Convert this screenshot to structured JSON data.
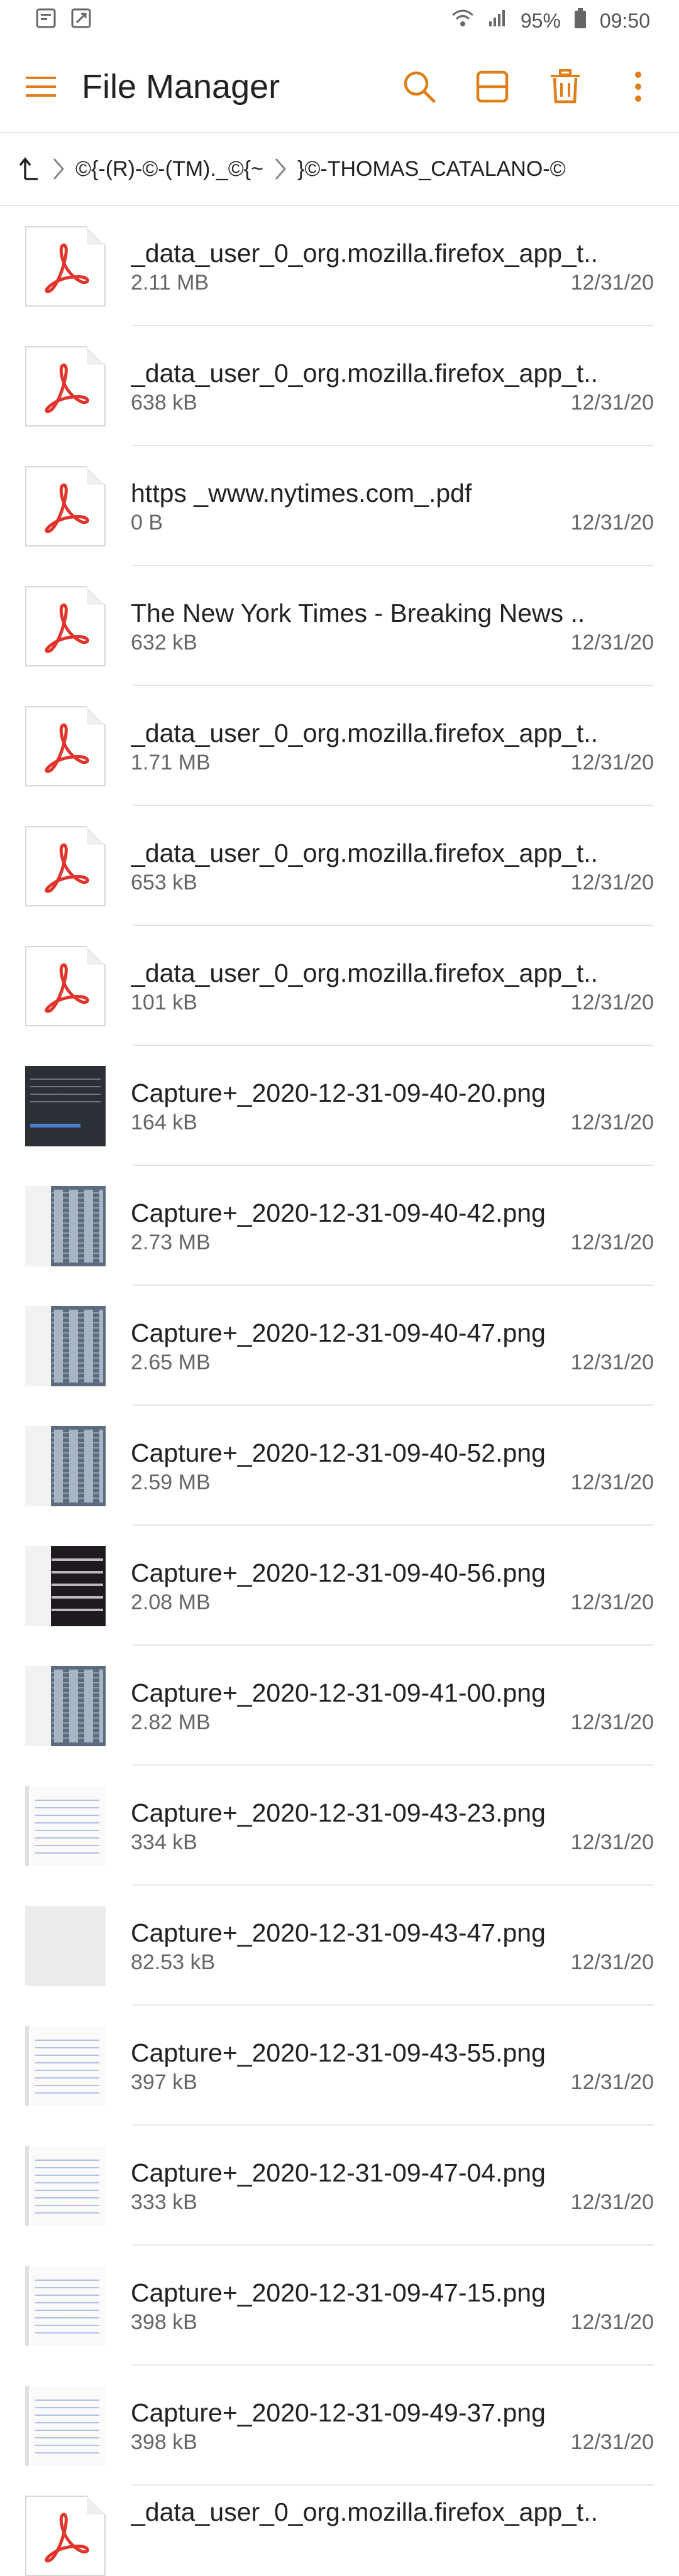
{
  "status": {
    "battery": "95%",
    "time": "09:50"
  },
  "appbar": {
    "title": "File Manager"
  },
  "breadcrumb": {
    "items": [
      "©{-(R)-©-(TM)._©{~",
      "}©-THOMAS_CATALANO-©"
    ]
  },
  "colors": {
    "accent": "#e07e1a",
    "pdf_red": "#e2342a"
  },
  "icons": [
    "menu-icon",
    "search-icon",
    "split-view-icon",
    "delete-icon",
    "more-icon",
    "up-arrow-icon",
    "chevron-right-icon",
    "pdf-icon"
  ],
  "files": [
    {
      "name": "_data_user_0_org.mozilla.firefox_app_t..",
      "size": "2.11 MB",
      "date": "12/31/20",
      "thumb": "pdf"
    },
    {
      "name": "_data_user_0_org.mozilla.firefox_app_t..",
      "size": "638 kB",
      "date": "12/31/20",
      "thumb": "pdf"
    },
    {
      "name": "https _www.nytimes.com_.pdf",
      "size": "0 B",
      "date": "12/31/20",
      "thumb": "pdf"
    },
    {
      "name": "The New York Times - Breaking News  ..",
      "size": "632 kB",
      "date": "12/31/20",
      "thumb": "pdf"
    },
    {
      "name": "_data_user_0_org.mozilla.firefox_app_t..",
      "size": "1.71 MB",
      "date": "12/31/20",
      "thumb": "pdf"
    },
    {
      "name": "_data_user_0_org.mozilla.firefox_app_t..",
      "size": "653 kB",
      "date": "12/31/20",
      "thumb": "pdf"
    },
    {
      "name": "_data_user_0_org.mozilla.firefox_app_t..",
      "size": "101 kB",
      "date": "12/31/20",
      "thumb": "pdf"
    },
    {
      "name": "Capture+_2020-12-31-09-40-20.png",
      "size": "164 kB",
      "date": "12/31/20",
      "thumb": "dark"
    },
    {
      "name": "Capture+_2020-12-31-09-40-42.png",
      "size": "2.73 MB",
      "date": "12/31/20",
      "thumb": "blue"
    },
    {
      "name": "Capture+_2020-12-31-09-40-47.png",
      "size": "2.65 MB",
      "date": "12/31/20",
      "thumb": "blue"
    },
    {
      "name": "Capture+_2020-12-31-09-40-52.png",
      "size": "2.59 MB",
      "date": "12/31/20",
      "thumb": "blue"
    },
    {
      "name": "Capture+_2020-12-31-09-40-56.png",
      "size": "2.08 MB",
      "date": "12/31/20",
      "thumb": "night"
    },
    {
      "name": "Capture+_2020-12-31-09-41-00.png",
      "size": "2.82 MB",
      "date": "12/31/20",
      "thumb": "blue"
    },
    {
      "name": "Capture+_2020-12-31-09-43-23.png",
      "size": "334 kB",
      "date": "12/31/20",
      "thumb": "doc"
    },
    {
      "name": "Capture+_2020-12-31-09-43-47.png",
      "size": "82.53 kB",
      "date": "12/31/20",
      "thumb": "blank"
    },
    {
      "name": "Capture+_2020-12-31-09-43-55.png",
      "size": "397 kB",
      "date": "12/31/20",
      "thumb": "doc"
    },
    {
      "name": "Capture+_2020-12-31-09-47-04.png",
      "size": "333 kB",
      "date": "12/31/20",
      "thumb": "doc"
    },
    {
      "name": "Capture+_2020-12-31-09-47-15.png",
      "size": "398 kB",
      "date": "12/31/20",
      "thumb": "doc"
    },
    {
      "name": "Capture+_2020-12-31-09-49-37.png",
      "size": "398 kB",
      "date": "12/31/20",
      "thumb": "doc"
    },
    {
      "name": "_data_user_0_org.mozilla.firefox_app_t..",
      "size": "",
      "date": "",
      "thumb": "pdf"
    }
  ]
}
